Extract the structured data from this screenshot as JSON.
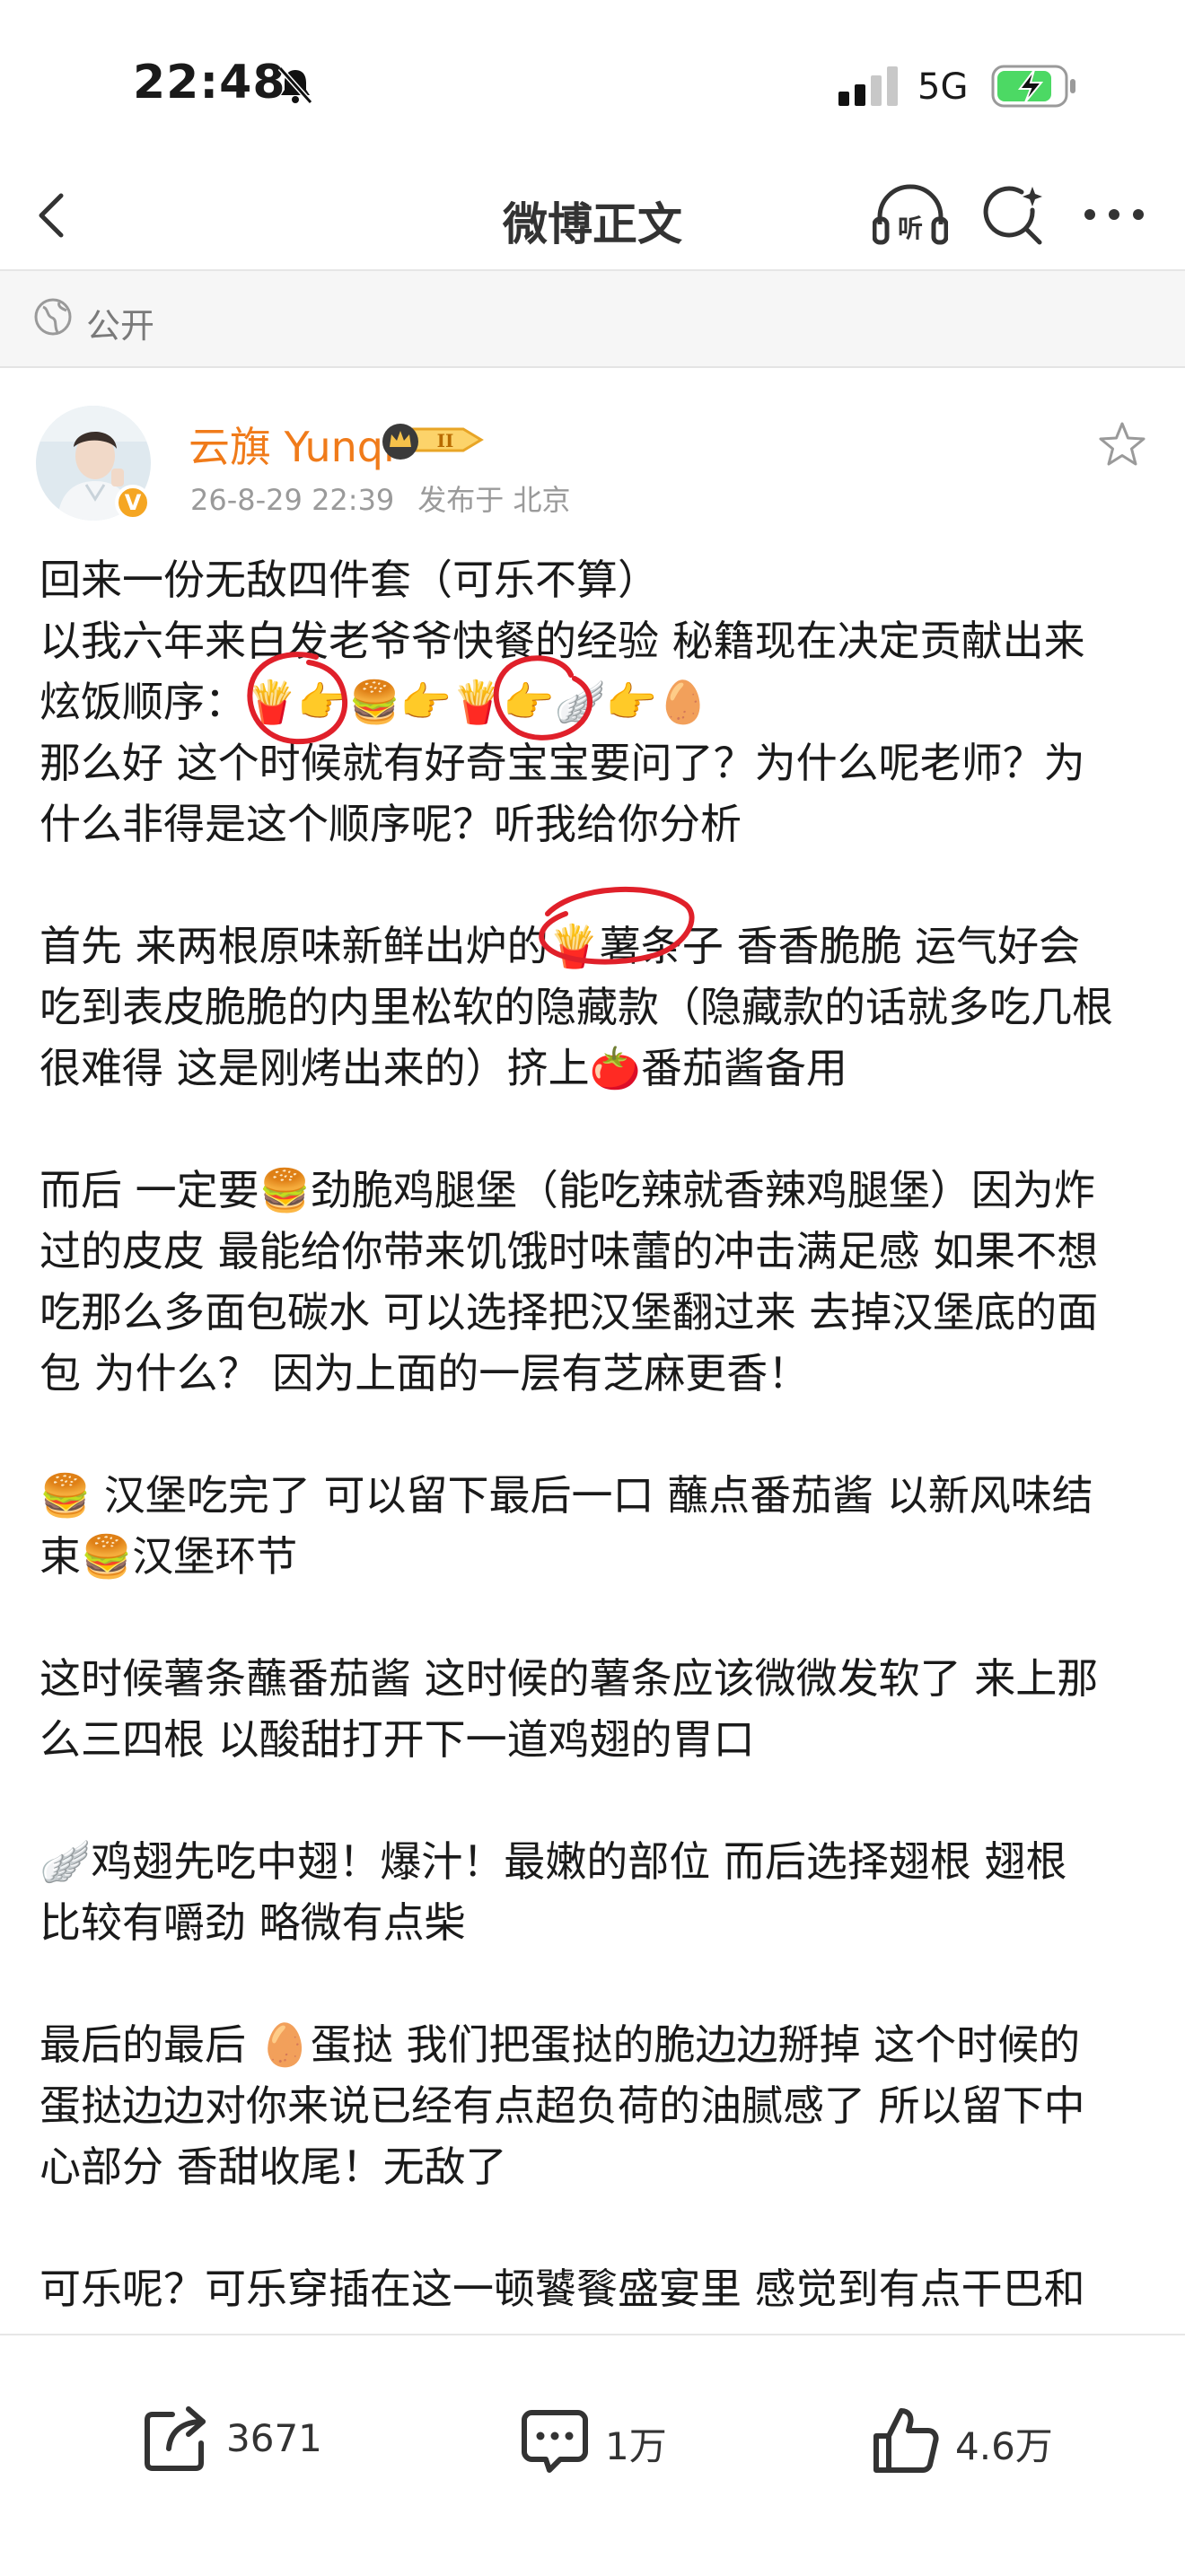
{
  "status_bar": {
    "time": "22:48",
    "network": "5G"
  },
  "nav": {
    "title": "微博正文"
  },
  "visibility": {
    "label": "公开"
  },
  "post": {
    "author": "云旗 Yunqi",
    "date": "26-8-29 22:39",
    "source": "发布于 北京",
    "lines": [
      "回来一份无敌四件套（可乐不算）",
      "以我六年来白发老爷爷快餐的经验 秘籍现在决定贡献出来",
      "炫饭顺序：🍟👉🍔👉🍟👉🪽👉🥚",
      "那么好 这个时候就有好奇宝宝要问了？为什么呢老师？为",
      "什么非得是这个顺序呢？听我给你分析",
      "首先 来两根原味新鲜出炉的🍟薯条子 香香脆脆 运气好会",
      "吃到表皮脆脆的内里松软的隐藏款（隐藏款的话就多吃几根",
      "很难得 这是刚烤出来的）挤上🍅番茄酱备用",
      "而后 一定要🍔劲脆鸡腿堡（能吃辣就香辣鸡腿堡）因为炸",
      "过的皮皮 最能给你带来饥饿时味蕾的冲击满足感 如果不想",
      "吃那么多面包碳水 可以选择把汉堡翻过来 去掉汉堡底的面",
      "包 为什么？ 因为上面的一层有芝麻更香！",
      "🍔 汉堡吃完了 可以留下最后一口 蘸点番茄酱 以新风味结",
      "束🍔汉堡环节",
      " 这时候薯条蘸番茄酱 这时候的薯条应该微微发软了 来上那",
      "么三四根 以酸甜打开下一道鸡翅的胃口",
      "🪽鸡翅先吃中翅！爆汁！最嫩的部位  而后选择翅根 翅根",
      "比较有嚼劲 略微有点柴",
      "最后的最后 🥚蛋挞 我们把蛋挞的脆边边掰掉 这个时候的",
      "蛋挞边边对你来说已经有点超负荷的油腻感了 所以留下中",
      "心部分 香甜收尾！无敌了",
      "可乐呢？可乐穿插在这一顿饕餮盛宴里 感觉到有点干巴和"
    ]
  },
  "actions": {
    "reposts": "3671",
    "comments": "1万",
    "likes": "4.6万"
  },
  "colors": {
    "author": "#f07b1a",
    "annotation": "#e0202a",
    "badge": "#f5a623"
  },
  "icons": [
    "bell-off-icon",
    "signal-icon",
    "battery-charging-icon",
    "back-icon",
    "listen-icon",
    "sparkle-search-icon",
    "more-icon",
    "globe-icon",
    "crown-badge-icon",
    "star-icon",
    "repost-icon",
    "comment-icon",
    "like-icon"
  ]
}
